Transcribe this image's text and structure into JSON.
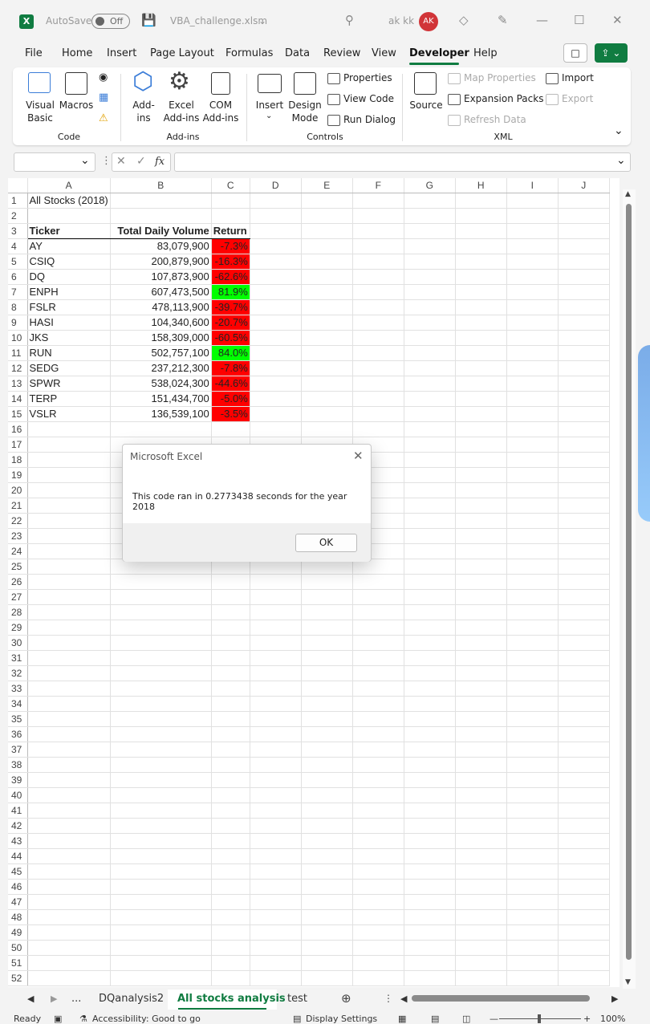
{
  "title_bar": {
    "autosave_label": "AutoSave",
    "autosave_state": "Off",
    "filename": "VBA_challenge.xlsm",
    "user_name": "ak kk",
    "user_initials": "AK"
  },
  "menu": {
    "items": [
      "File",
      "Home",
      "Insert",
      "Page Layout",
      "Formulas",
      "Data",
      "Review",
      "View",
      "Developer",
      "Help"
    ],
    "active": "Developer"
  },
  "ribbon": {
    "code": {
      "group": "Code",
      "visual_basic": "Visual\nBasic",
      "macros": "Macros"
    },
    "addins": {
      "group": "Add-ins",
      "addins": "Add-\nins",
      "excel_addins": "Excel\nAdd-ins",
      "com_addins": "COM\nAdd-ins"
    },
    "controls": {
      "group": "Controls",
      "insert": "Insert",
      "design_mode": "Design\nMode",
      "properties": "Properties",
      "view_code": "View Code",
      "run_dialog": "Run Dialog"
    },
    "xml": {
      "group": "XML",
      "source": "Source",
      "map_properties": "Map Properties",
      "import": "Import",
      "expansion_packs": "Expansion Packs",
      "export": "Export",
      "refresh_data": "Refresh Data"
    }
  },
  "formula_bar": {
    "fx": "fx",
    "name_box": "",
    "formula": ""
  },
  "columns": [
    "A",
    "B",
    "C",
    "D",
    "E",
    "F",
    "G",
    "H",
    "I",
    "J"
  ],
  "sheet": {
    "title": "All Stocks (2018)",
    "headers": [
      "Ticker",
      "Total Daily Volume",
      "Return"
    ],
    "rows": [
      {
        "ticker": "AY",
        "volume": "83,079,900",
        "ret": "-7.3%",
        "positive": false
      },
      {
        "ticker": "CSIQ",
        "volume": "200,879,900",
        "ret": "-16.3%",
        "positive": false
      },
      {
        "ticker": "DQ",
        "volume": "107,873,900",
        "ret": "-62.6%",
        "positive": false
      },
      {
        "ticker": "ENPH",
        "volume": "607,473,500",
        "ret": "81.9%",
        "positive": true
      },
      {
        "ticker": "FSLR",
        "volume": "478,113,900",
        "ret": "-39.7%",
        "positive": false
      },
      {
        "ticker": "HASI",
        "volume": "104,340,600",
        "ret": "-20.7%",
        "positive": false
      },
      {
        "ticker": "JKS",
        "volume": "158,309,000",
        "ret": "-60.5%",
        "positive": false
      },
      {
        "ticker": "RUN",
        "volume": "502,757,100",
        "ret": "84.0%",
        "positive": true
      },
      {
        "ticker": "SEDG",
        "volume": "237,212,300",
        "ret": "-7.8%",
        "positive": false
      },
      {
        "ticker": "SPWR",
        "volume": "538,024,300",
        "ret": "-44.6%",
        "positive": false
      },
      {
        "ticker": "TERP",
        "volume": "151,434,700",
        "ret": "-5.0%",
        "positive": false
      },
      {
        "ticker": "VSLR",
        "volume": "136,539,100",
        "ret": "-3.5%",
        "positive": false
      }
    ],
    "row_count": 52
  },
  "dialog": {
    "title": "Microsoft Excel",
    "message": "This code ran in 0.2773438 seconds for the year 2018",
    "ok_label": "OK"
  },
  "sheet_tabs": {
    "more": "...",
    "tabs": [
      "DQanalysis2",
      "All stocks analysis",
      "test"
    ],
    "active": "All stocks analysis"
  },
  "status_bar": {
    "ready": "Ready",
    "accessibility": "Accessibility: Good to go",
    "display_settings": "Display Settings",
    "zoom": "100%"
  },
  "colors": {
    "accent": "#107c41",
    "negative": "#ff0000",
    "positive": "#00ff00"
  }
}
